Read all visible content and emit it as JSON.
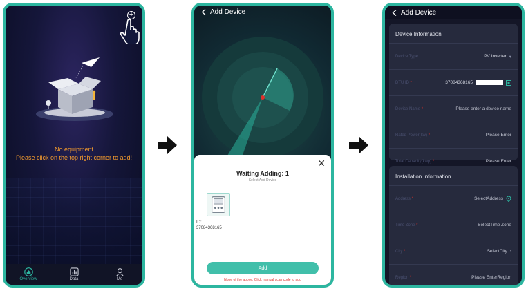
{
  "colors": {
    "accent": "#2db6a0",
    "warning": "#f29a2e",
    "danger": "#e0312b"
  },
  "screen1": {
    "plus_icon": "+",
    "empty_line1": "No equipment",
    "empty_line2": "Please click on the top right corner to add!",
    "tabs": [
      {
        "label": "Overview",
        "icon": "home-icon",
        "active": true
      },
      {
        "label": "Data",
        "icon": "chart-icon",
        "active": false
      },
      {
        "label": "Me",
        "icon": "user-icon",
        "active": false
      }
    ]
  },
  "screen2": {
    "header_title": "Add Device",
    "close_glyph": "✕",
    "waiting_title": "Waiting Adding:  1",
    "waiting_sub": "Select Add Device",
    "device_id_label": "ID:",
    "device_id": "37084368165",
    "add_button": "Add",
    "scan_hint": "None of the above, Click manual scan code to add"
  },
  "screen3": {
    "header_title": "Add Device",
    "device_info": {
      "title": "Device Information",
      "rows": [
        {
          "label": "Device Type",
          "required": false,
          "value": "PV Inverter",
          "suffix": "▾"
        },
        {
          "label": "DTU ID",
          "required": true,
          "value": "37084368165",
          "suffix": ""
        },
        {
          "label": "Device Name",
          "required": true,
          "value": "Please enter a device name",
          "suffix": ""
        },
        {
          "label": "Rated Power(kw)",
          "required": true,
          "value": "Please Enter",
          "suffix": ""
        },
        {
          "label": "Total Capacity(kwp)",
          "required": true,
          "value": "Please Enter",
          "suffix": ""
        }
      ]
    },
    "install_info": {
      "title": "Installation Information",
      "rows": [
        {
          "label": "Address",
          "required": true,
          "value": "SelectAddress",
          "suffix": ""
        },
        {
          "label": "Time Zone",
          "required": true,
          "value": "SelectTime Zone",
          "suffix": ""
        },
        {
          "label": "City",
          "required": true,
          "value": "SelectCity",
          "suffix": "›"
        },
        {
          "label": "Region",
          "required": true,
          "value": "Please EnterRegion",
          "suffix": ""
        }
      ]
    }
  }
}
